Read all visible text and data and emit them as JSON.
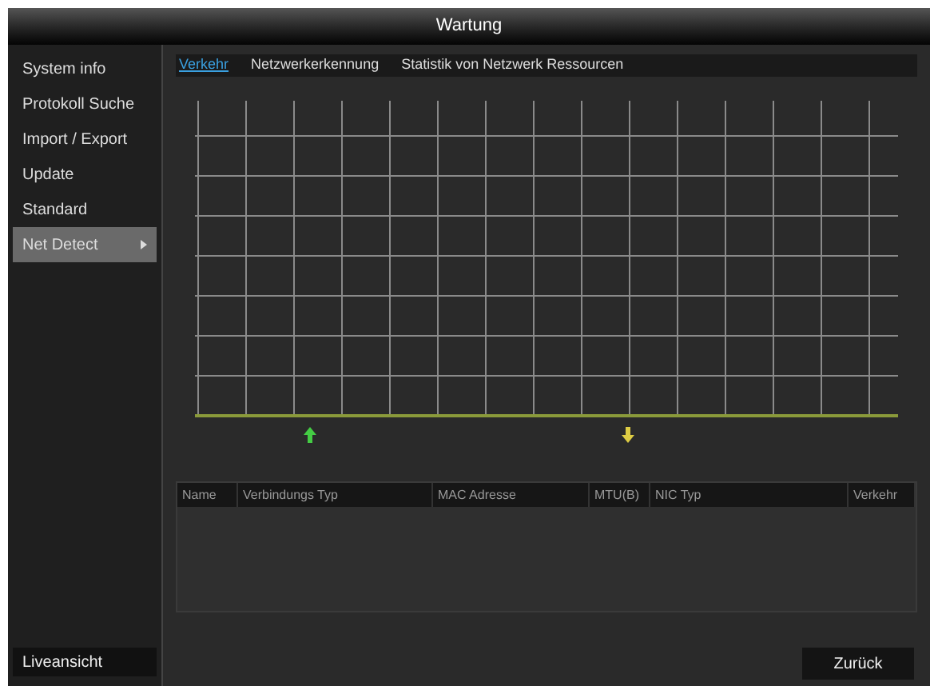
{
  "window": {
    "title": "Wartung"
  },
  "sidebar": {
    "items": [
      {
        "label": "System info",
        "selected": false
      },
      {
        "label": "Protokoll Suche",
        "selected": false
      },
      {
        "label": "Import / Export",
        "selected": false
      },
      {
        "label": "Update",
        "selected": false
      },
      {
        "label": "Standard",
        "selected": false
      },
      {
        "label": "Net Detect",
        "selected": true
      }
    ],
    "bottom_button": "Liveansicht"
  },
  "tabs": [
    {
      "label": "Verkehr",
      "selected": true
    },
    {
      "label": "Netzwerkerkennung",
      "selected": false
    },
    {
      "label": "Statistik von Netzwerk Ressourcen",
      "selected": false
    }
  ],
  "table": {
    "columns": [
      "Name",
      "Verbindungs Typ",
      "MAC Adresse",
      "MTU(B)",
      "NIC Typ",
      "Verkehr"
    ]
  },
  "buttons": [
    "Zurück"
  ]
}
